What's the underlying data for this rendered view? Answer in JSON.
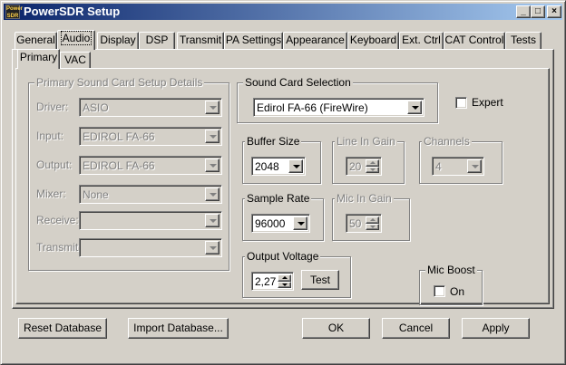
{
  "window": {
    "title": "PowerSDR Setup",
    "icon_text": "Power SDR",
    "minimize": "_",
    "maximize": "□",
    "close": "×"
  },
  "tabs": [
    {
      "label": "General"
    },
    {
      "label": "Audio",
      "active": true
    },
    {
      "label": "Display"
    },
    {
      "label": "DSP"
    },
    {
      "label": "Transmit"
    },
    {
      "label": "PA Settings"
    },
    {
      "label": "Appearance"
    },
    {
      "label": "Keyboard"
    },
    {
      "label": "Ext. Ctrl"
    },
    {
      "label": "CAT Control"
    },
    {
      "label": "Tests"
    }
  ],
  "subtabs": [
    {
      "label": "Primary",
      "active": true
    },
    {
      "label": "VAC"
    }
  ],
  "details": {
    "title": "Primary Sound Card Setup Details",
    "driver_label": "Driver:",
    "driver_value": "ASIO",
    "input_label": "Input:",
    "input_value": "EDIROL FA-66",
    "output_label": "Output:",
    "output_value": "EDIROL FA-66",
    "mixer_label": "Mixer:",
    "mixer_value": "None",
    "receive_label": "Receive:",
    "receive_value": "",
    "transmit_label": "Transmit:",
    "transmit_value": ""
  },
  "sound_card": {
    "title": "Sound Card Selection",
    "value": "Edirol FA-66 (FireWire)"
  },
  "expert": {
    "label": "Expert",
    "checked": false
  },
  "buffer_size": {
    "title": "Buffer Size",
    "value": "2048"
  },
  "line_in_gain": {
    "title": "Line In Gain",
    "value": "20"
  },
  "channels": {
    "title": "Channels",
    "value": "4"
  },
  "sample_rate": {
    "title": "Sample Rate",
    "value": "96000"
  },
  "mic_in_gain": {
    "title": "Mic In Gain",
    "value": "50"
  },
  "output_voltage": {
    "title": "Output Voltage",
    "value": "2,27",
    "test_label": "Test"
  },
  "mic_boost": {
    "title": "Mic Boost",
    "label": "On",
    "checked": false
  },
  "footer": {
    "reset_label": "Reset Database",
    "import_label": "Import Database...",
    "ok_label": "OK",
    "cancel_label": "Cancel",
    "apply_label": "Apply"
  }
}
